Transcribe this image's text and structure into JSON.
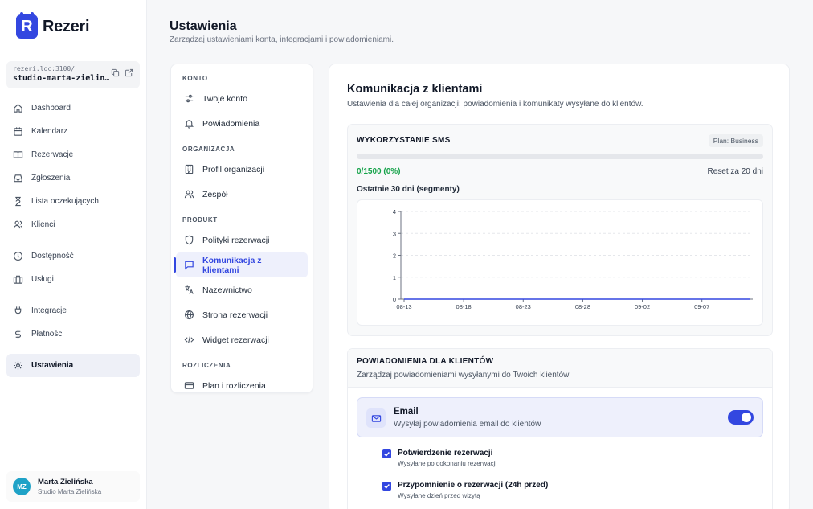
{
  "app": {
    "name": "Rezeri",
    "logo_letter": "R",
    "accent": "#3347e0"
  },
  "workspace": {
    "url_host": "rezeri.loc:3100/",
    "url_slug": "studio-marta-zielin…"
  },
  "nav": {
    "items": [
      {
        "label": "Dashboard",
        "icon": "home-icon"
      },
      {
        "label": "Kalendarz",
        "icon": "calendar-icon"
      },
      {
        "label": "Rezerwacje",
        "icon": "book-icon"
      },
      {
        "label": "Zgłoszenia",
        "icon": "inbox-icon"
      },
      {
        "label": "Lista oczekujących",
        "icon": "hourglass-icon"
      },
      {
        "label": "Klienci",
        "icon": "users-icon"
      },
      {
        "label": "Dostępność",
        "icon": "clock-icon"
      },
      {
        "label": "Usługi",
        "icon": "briefcase-icon"
      },
      {
        "label": "Integracje",
        "icon": "plug-icon"
      },
      {
        "label": "Płatności",
        "icon": "dollar-icon"
      },
      {
        "label": "Ustawienia",
        "icon": "gear-icon"
      }
    ]
  },
  "user": {
    "initials": "MZ",
    "name": "Marta Zielińska",
    "org": "Studio Marta Zielińska"
  },
  "header": {
    "title": "Ustawienia",
    "subtitle": "Zarządzaj ustawieniami konta, integracjami i powiadomieniami."
  },
  "settings_menu": {
    "sections": {
      "konto": "KONTO",
      "organizacja": "ORGANIZACJA",
      "produkt": "PRODUKT",
      "rozliczenia": "ROZLICZENIA"
    },
    "items": {
      "twoje_konto": "Twoje konto",
      "powiadomienia": "Powiadomienia",
      "profil": "Profil organizacji",
      "zespol": "Zespół",
      "polityki": "Polityki rezerwacji",
      "komunikacja": "Komunikacja z klientami",
      "nazewnictwo": "Nazewnictwo",
      "strona": "Strona rezerwacji",
      "widget": "Widget rezerwacji",
      "plan": "Plan i rozliczenia"
    },
    "active": "Komunikacja z klientami"
  },
  "panel": {
    "title": "Komunikacja z klientami",
    "subtitle": "Ustawienia dla całej organizacji: powiadomienia i komunikaty wysyłane do klientów."
  },
  "sms": {
    "title": "WYKORZYSTANIE SMS",
    "plan_badge": "Plan: Business",
    "usage_text": "0/1500 (0%)",
    "usage_fraction": 0,
    "reset_text": "Reset za 20 dni",
    "chart_label": "Ostatnie 30 dni (segmenty)",
    "usage_color": "#16a34a"
  },
  "chart_data": {
    "type": "line",
    "x_ticks": [
      "08-13",
      "08-18",
      "08-23",
      "08-28",
      "09-02",
      "09-07"
    ],
    "y_ticks": [
      "0",
      "1",
      "2",
      "3",
      "4"
    ],
    "ylim": [
      0,
      4
    ],
    "grid": "horizontal dashed",
    "series": [
      {
        "values": [
          0,
          0,
          0,
          0,
          0,
          0,
          0,
          0,
          0,
          0,
          0,
          0,
          0,
          0,
          0,
          0,
          0,
          0,
          0,
          0,
          0,
          0,
          0,
          0,
          0,
          0,
          0,
          0,
          0,
          0
        ]
      }
    ]
  },
  "notifications": {
    "title": "POWIADOMIENIA DLA KLIENTÓW",
    "subtitle": "Zarządzaj powiadomieniami wysyłanymi do Twoich klientów",
    "email": {
      "title": "Email",
      "subtitle": "Wysyłaj powiadomienia email do klientów",
      "enabled": true
    },
    "checks": [
      {
        "title": "Potwierdzenie rezerwacji",
        "subtitle": "Wysyłane po dokonaniu rezerwacji",
        "checked": true
      },
      {
        "title": "Przypomnienie o rezerwacji (24h przed)",
        "subtitle": "Wysyłane dzień przed wizytą",
        "checked": true
      }
    ]
  }
}
